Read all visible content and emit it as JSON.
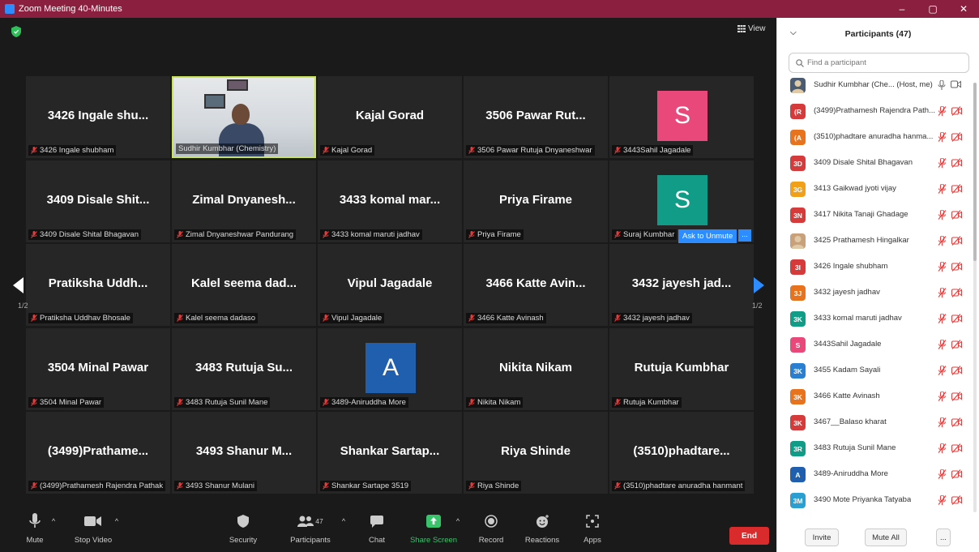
{
  "window": {
    "title": "Zoom Meeting 40-Minutes",
    "controls": [
      "–",
      "▢",
      "✕"
    ]
  },
  "stage": {
    "view_label": "View",
    "ask_to_unmute": "Ask to Unmute",
    "more_label": "...",
    "page_left": "1/2",
    "page_right": "1/2",
    "tiles": [
      {
        "big": "3426 Ingale shu...",
        "label": "3426 Ingale shubham"
      },
      {
        "video": true,
        "label": "Sudhir Kumbhar (Chemistry)"
      },
      {
        "big": "Kajal Gorad",
        "label": "Kajal Gorad"
      },
      {
        "big": "3506 Pawar Rut...",
        "label": "3506 Pawar Rutuja Dnyaneshwar"
      },
      {
        "avatar": "S",
        "avatar_color": "#e8497a",
        "label": "3443Sahil Jagadale"
      },
      {
        "big": "3409 Disale Shit...",
        "label": "3409 Disale Shital Bhagavan"
      },
      {
        "big": "Zimal Dnyanesh...",
        "label": "Zimal Dnyaneshwar Pandurang"
      },
      {
        "big": "3433 komal mar...",
        "label": "3433 komal maruti jadhav"
      },
      {
        "big": "Priya Firame",
        "label": "Priya Firame"
      },
      {
        "avatar": "S",
        "avatar_color": "#119c87",
        "label": "Suraj Kumbhar"
      },
      {
        "big": "Pratiksha Uddh...",
        "label": "Pratiksha Uddhav Bhosale"
      },
      {
        "big": "Kalel seema dad...",
        "label": "Kalel seema dadaso"
      },
      {
        "big": "Vipul Jagadale",
        "label": "Vipul Jagadale"
      },
      {
        "big": "3466 Katte Avin...",
        "label": "3466 Katte Avinash"
      },
      {
        "big": "3432 jayesh jad...",
        "label": "3432 jayesh jadhav"
      },
      {
        "big": "3504 Minal Pawar",
        "label": "3504 Minal Pawar"
      },
      {
        "big": "3483 Rutuja Su...",
        "label": "3483 Rutuja Sunil Mane"
      },
      {
        "avatar": "A",
        "avatar_color": "#1f5fae",
        "label": "3489-Aniruddha More"
      },
      {
        "big": "Nikita Nikam",
        "label": "Nikita Nikam"
      },
      {
        "big": "Rutuja Kumbhar",
        "label": "Rutuja Kumbhar"
      },
      {
        "big": "(3499)Prathame...",
        "label": "(3499)Prathamesh Rajendra Pathak"
      },
      {
        "big": "3493 Shanur M...",
        "label": "3493 Shanur Mulani"
      },
      {
        "big": "Shankar Sartap...",
        "label": "Shankar Sartape 3519"
      },
      {
        "big": "Riya Shinde",
        "label": "Riya Shinde"
      },
      {
        "big": "(3510)phadtare...",
        "label": "(3510)phadtare anuradha hanmant"
      }
    ]
  },
  "toolbar": {
    "mute": "Mute",
    "stop_video": "Stop Video",
    "security": "Security",
    "participants": "Participants",
    "participants_count": "47",
    "chat": "Chat",
    "share_screen": "Share Screen",
    "record": "Record",
    "reactions": "Reactions",
    "apps": "Apps",
    "end": "End"
  },
  "panel": {
    "title": "Participants (47)",
    "search_placeholder": "Find a participant",
    "participants": [
      {
        "initials": "",
        "photo": true,
        "color": "#4a5a70",
        "name": "Sudhir Kumbhar (Che...  (Host, me)",
        "host": true
      },
      {
        "initials": "(R",
        "color": "#d63b3b",
        "name": "(3499)Prathamesh Rajendra Path..."
      },
      {
        "initials": "(A",
        "color": "#e8731f",
        "name": "(3510)phadtare anuradha hanma..."
      },
      {
        "initials": "3D",
        "color": "#d63b3b",
        "name": "3409 Disale Shital Bhagavan"
      },
      {
        "initials": "3G",
        "color": "#f0a019",
        "name": "3413 Gaikwad jyoti vijay"
      },
      {
        "initials": "3N",
        "color": "#d63b3b",
        "name": "3417 Nikita Tanaji Ghadage"
      },
      {
        "initials": "",
        "photo": true,
        "color": "#c8a07a",
        "name": "3425 Prathamesh Hingalkar"
      },
      {
        "initials": "3I",
        "color": "#d63b3b",
        "name": "3426 Ingale shubham"
      },
      {
        "initials": "3J",
        "color": "#e8731f",
        "name": "3432 jayesh jadhav"
      },
      {
        "initials": "3K",
        "color": "#119c87",
        "name": "3433 komal maruti jadhav"
      },
      {
        "initials": "S",
        "color": "#e8497a",
        "name": "3443Sahil Jagadale"
      },
      {
        "initials": "3K",
        "color": "#2a7fd0",
        "name": "3455 Kadam Sayali"
      },
      {
        "initials": "3K",
        "color": "#e8731f",
        "name": "3466 Katte Avinash"
      },
      {
        "initials": "3K",
        "color": "#d63b3b",
        "name": "3467__Balaso kharat"
      },
      {
        "initials": "3R",
        "color": "#119c87",
        "name": "3483 Rutuja Sunil Mane"
      },
      {
        "initials": "A",
        "color": "#1f5fae",
        "name": "3489-Aniruddha More"
      },
      {
        "initials": "3M",
        "color": "#2a9fd0",
        "name": "3490 Mote Priyanka Tatyaba"
      }
    ],
    "invite": "Invite",
    "mute_all": "Mute All",
    "more": "..."
  }
}
